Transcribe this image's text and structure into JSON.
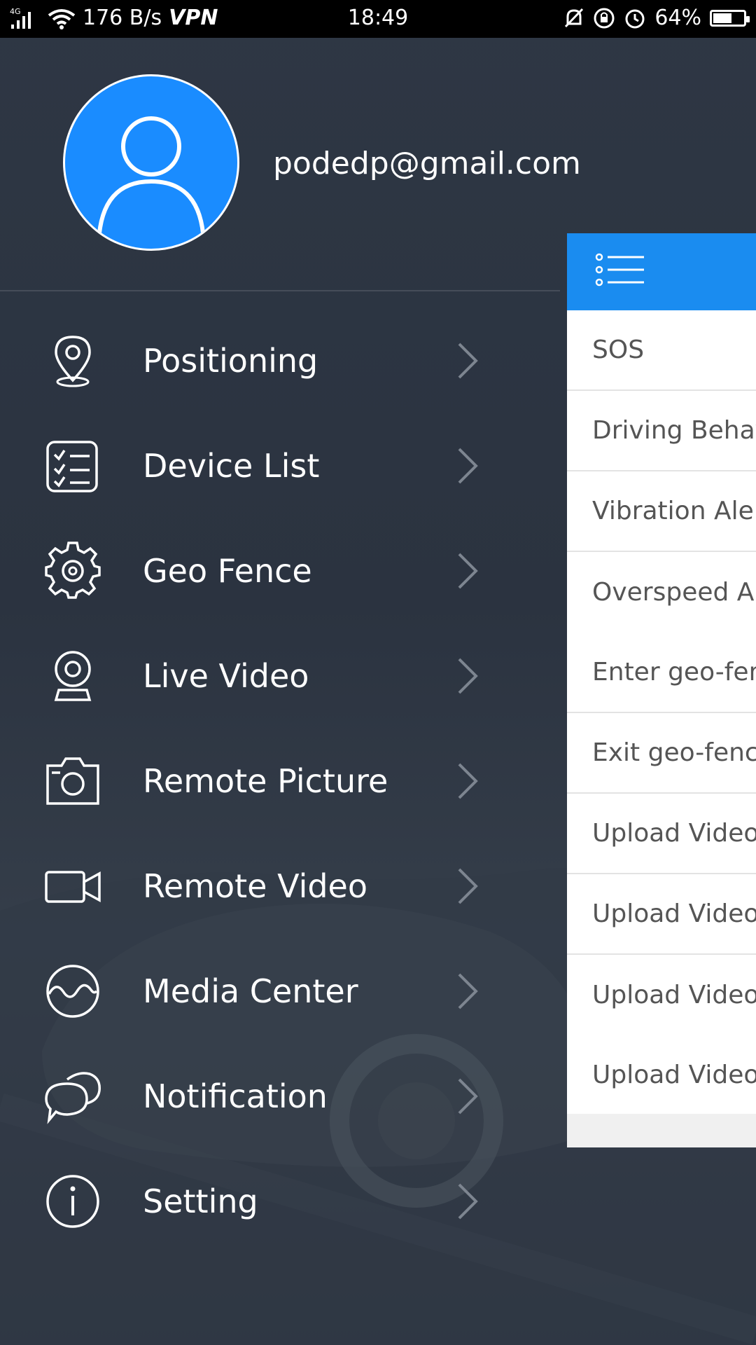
{
  "status_bar": {
    "network": "4G",
    "speed": "176 B/s",
    "vpn": "VPN",
    "time": "18:49",
    "battery": "64%",
    "battery_level": 0.64
  },
  "profile": {
    "email": "podedp@gmail.com"
  },
  "menu": {
    "items": [
      {
        "label": "Positioning",
        "icon": "location-pin-icon"
      },
      {
        "label": "Device List",
        "icon": "checklist-icon"
      },
      {
        "label": "Geo Fence",
        "icon": "gear-icon"
      },
      {
        "label": "Live Video",
        "icon": "webcam-icon"
      },
      {
        "label": "Remote Picture",
        "icon": "camera-icon"
      },
      {
        "label": "Remote Video",
        "icon": "video-camera-icon"
      },
      {
        "label": "Media Center",
        "icon": "wave-circle-icon"
      },
      {
        "label": "Notification",
        "icon": "chat-bubbles-icon"
      },
      {
        "label": "Setting",
        "icon": "info-icon"
      }
    ]
  },
  "panel": {
    "header_icon": "list-icon",
    "header_color": "#1a8cf0",
    "rows": [
      "SOS",
      "Driving Behavi",
      "Vibration Alert",
      "Overspeed Ale",
      "Enter geo-fenc",
      "Exit geo-fence",
      "Upload Video-",
      "Upload Video-",
      "Upload Video-",
      "Upload Video-"
    ]
  },
  "colors": {
    "accent": "#1a8cff",
    "background": "#2c3440"
  }
}
